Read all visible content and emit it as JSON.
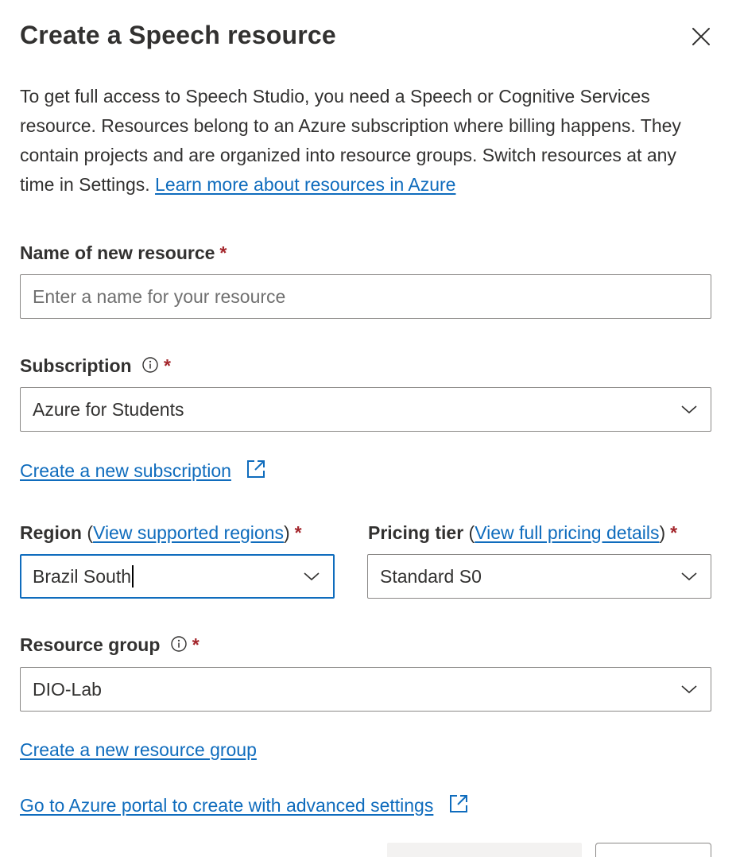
{
  "dialog": {
    "title": "Create a Speech resource",
    "description": "To get full access to Speech Studio, you need a Speech or Cognitive Services resource. Resources belong to an Azure subscription where billing happens. They contain projects and are organized into resource groups. Switch resources at any time in Settings.",
    "learn_more_link": "Learn more about resources in Azure"
  },
  "name_field": {
    "label": "Name of new resource",
    "required_marker": "*",
    "value": "",
    "placeholder": "Enter a name for your resource"
  },
  "subscription": {
    "label": "Subscription",
    "required_marker": "*",
    "selected": "Azure for Students",
    "create_link": "Create a new subscription"
  },
  "region": {
    "label": "Region",
    "paren_open": "(",
    "link": "View supported regions",
    "paren_close": ")",
    "required_marker": "*",
    "selected": "Brazil South"
  },
  "pricing_tier": {
    "label": "Pricing tier",
    "paren_open": "(",
    "link": "View full pricing details",
    "paren_close": ")",
    "required_marker": "*",
    "selected": "Standard S0"
  },
  "resource_group": {
    "label": "Resource group",
    "required_marker": "*",
    "selected": "DIO-Lab",
    "create_link": "Create a new resource group"
  },
  "advanced_link": "Go to Azure portal to create with advanced settings",
  "icons": {
    "close": "close-icon",
    "info": "info-icon",
    "chevron": "chevron-down-icon",
    "external": "external-link-icon"
  },
  "colors": {
    "link": "#0f6cbd",
    "required": "#a4262c",
    "focus_border": "#0f6cbd",
    "text": "#323130"
  }
}
